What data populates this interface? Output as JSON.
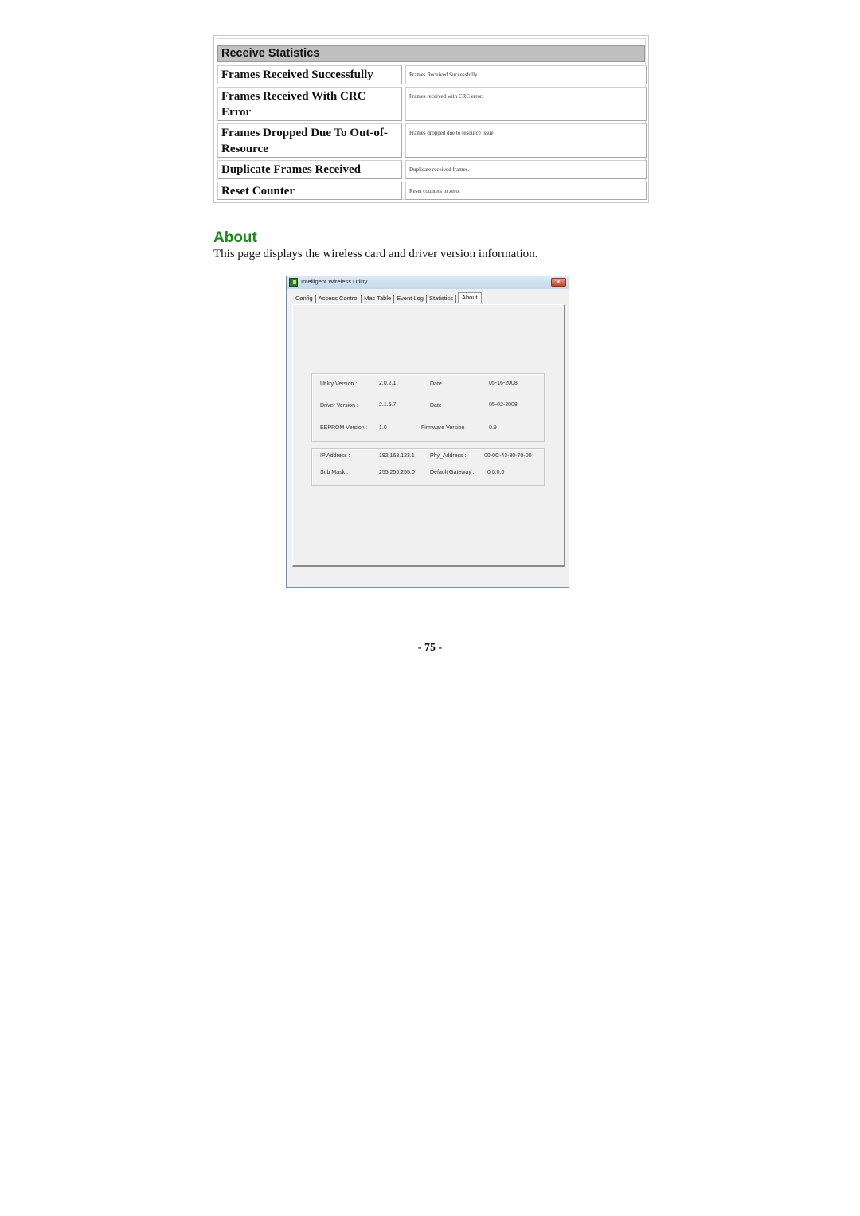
{
  "receive_statistics": {
    "header": "Receive Statistics",
    "rows": [
      {
        "key": "Frames Received Successfully",
        "value": "Frames Received Successfully"
      },
      {
        "key": "Frames Received With CRC Error",
        "value": "Frames received with CRC error."
      },
      {
        "key": "Frames Dropped Due To Out-of-Resource",
        "value": "Frames dropped due to resource issue"
      },
      {
        "key": "Duplicate Frames Received",
        "value": "Duplicate received frames."
      },
      {
        "key": "Reset Counter",
        "value": "Reset counters to zero."
      }
    ]
  },
  "about": {
    "title": "About",
    "description": "This page displays the wireless card and driver version information."
  },
  "window": {
    "title": "Intelligent Wireless Utility",
    "close_glyph": "x",
    "tabs": [
      {
        "label": "Config",
        "active": false
      },
      {
        "label": "Access Control",
        "active": false
      },
      {
        "label": "Mac Table",
        "active": false
      },
      {
        "label": "Event Log",
        "active": false
      },
      {
        "label": "Statistics",
        "active": false
      },
      {
        "label": "About",
        "active": true
      }
    ],
    "version_info": {
      "utility_version_label": "Utility Version :",
      "utility_version": "2.0.2.1",
      "utility_date_label": "Date :",
      "utility_date": "05-16-2008",
      "driver_version_label": "Driver Version :",
      "driver_version": "2.1.6.7",
      "driver_date_label": "Date :",
      "driver_date": "05-02-2008",
      "eeprom_version_label": "EEPROM Version :",
      "eeprom_version": "1.0",
      "firmware_version_label": "Firmware Version :",
      "firmware_version": "0.9"
    },
    "network_info": {
      "ip_address_label": "IP Address :",
      "ip_address": "192.168.123.1",
      "phy_address_label": "Phy_Address :",
      "phy_address": "00-0C-43-30-70-00",
      "sub_mask_label": "Sub Mask :",
      "sub_mask": "255.255.255.0",
      "default_gateway_label": "Default Gateway :",
      "default_gateway": "0.0.0.0"
    }
  },
  "page_number": "- 75 -"
}
